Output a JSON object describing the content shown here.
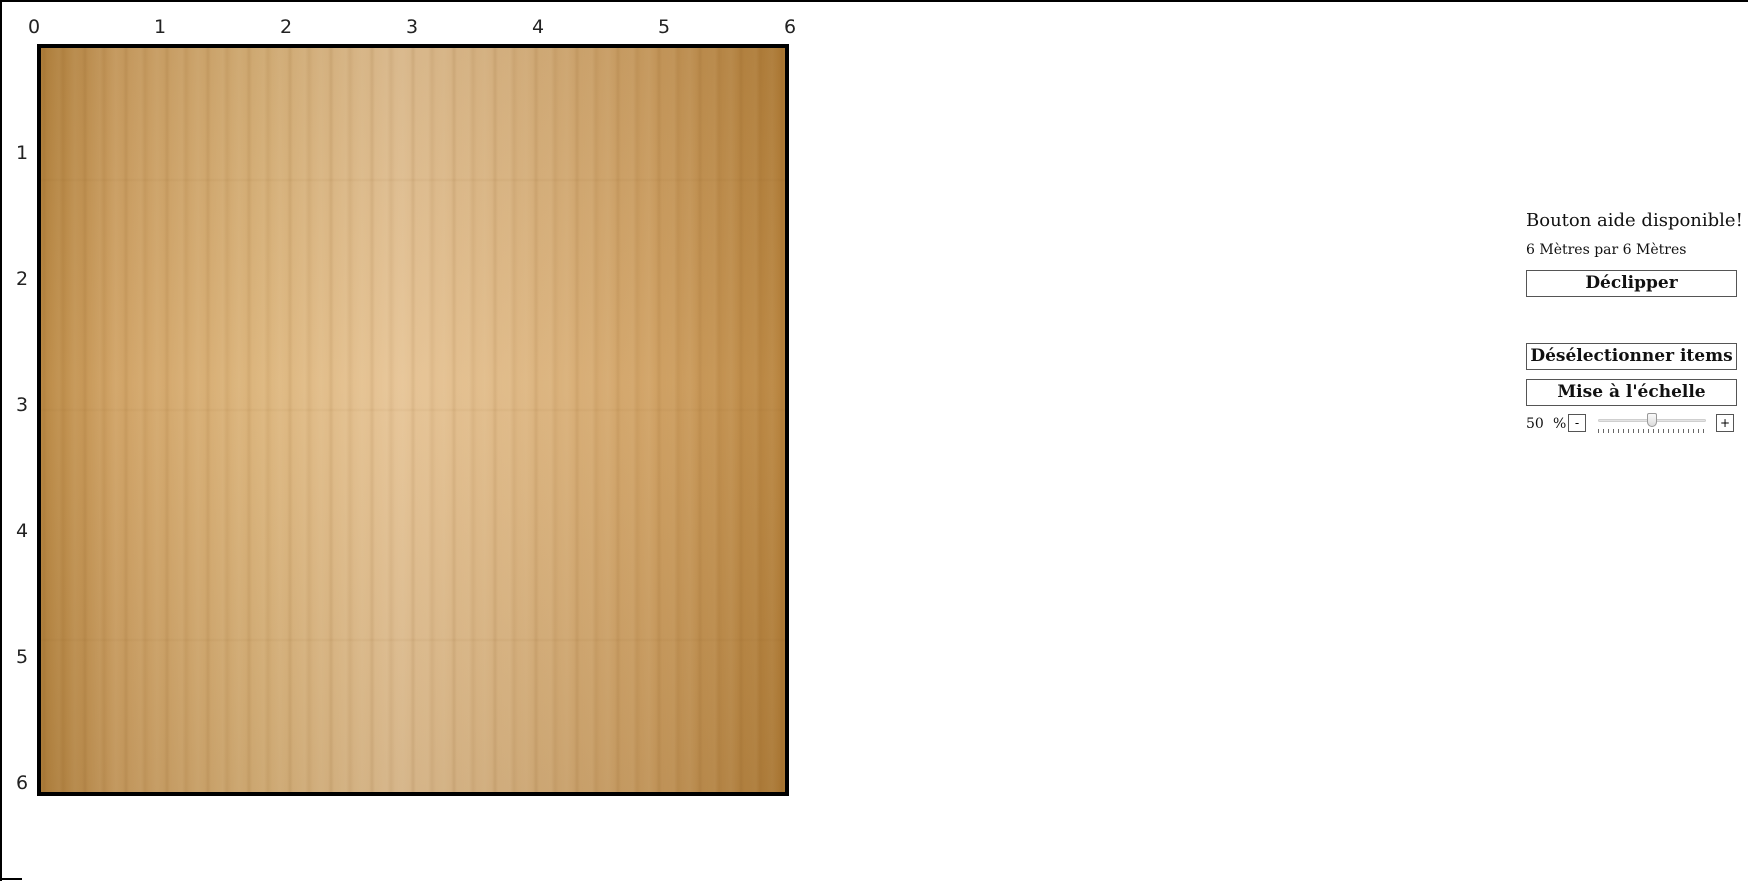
{
  "ruler": {
    "x_labels": [
      "0",
      "1",
      "2",
      "3",
      "4",
      "5",
      "6"
    ],
    "y_labels": [
      "1",
      "2",
      "3",
      "4",
      "5",
      "6"
    ]
  },
  "floor": {
    "texture": "light wood parquet",
    "border_color": "#000000"
  },
  "panel": {
    "help_text": "Bouton aide disponible!",
    "dimensions_text": "6 Mètres par 6 Mètres",
    "unclip_label": "Déclipper",
    "deselect_label": "Désélectionner items",
    "scale_label": "Mise à l'échelle",
    "zoom": {
      "value": "50",
      "unit": "%",
      "minus_label": "-",
      "plus_label": "+",
      "slider_level": 0.5
    }
  }
}
